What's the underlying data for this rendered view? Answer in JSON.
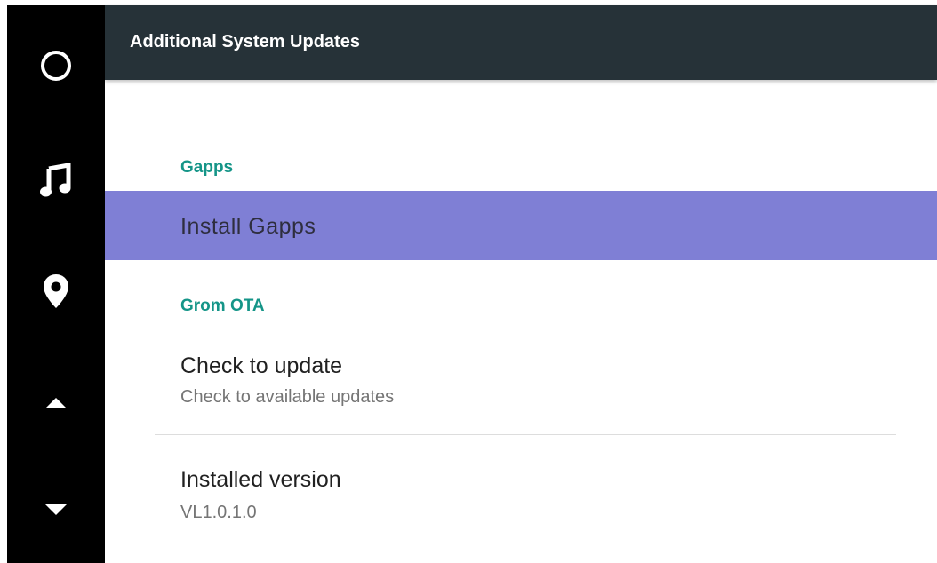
{
  "sidebar": {
    "buttons": [
      {
        "icon": "home-circle-icon"
      },
      {
        "icon": "music-note-icon"
      },
      {
        "icon": "location-pin-icon"
      },
      {
        "icon": "arrow-up-icon"
      },
      {
        "icon": "arrow-down-icon"
      }
    ]
  },
  "appbar": {
    "title": "Additional System Updates",
    "color": "#263238"
  },
  "sections": [
    {
      "header": "Gapps",
      "items": [
        {
          "title": "Install Gapps",
          "highlighted": true
        }
      ]
    },
    {
      "header": "Grom OTA",
      "items": [
        {
          "title": "Check to update",
          "summary": "Check to available updates"
        },
        {
          "title": "Installed version",
          "summary": "VL1.0.1.0"
        }
      ]
    }
  ],
  "colors": {
    "accent": "#159588",
    "highlight": "#7f7fd5",
    "sidebar": "#000000"
  }
}
